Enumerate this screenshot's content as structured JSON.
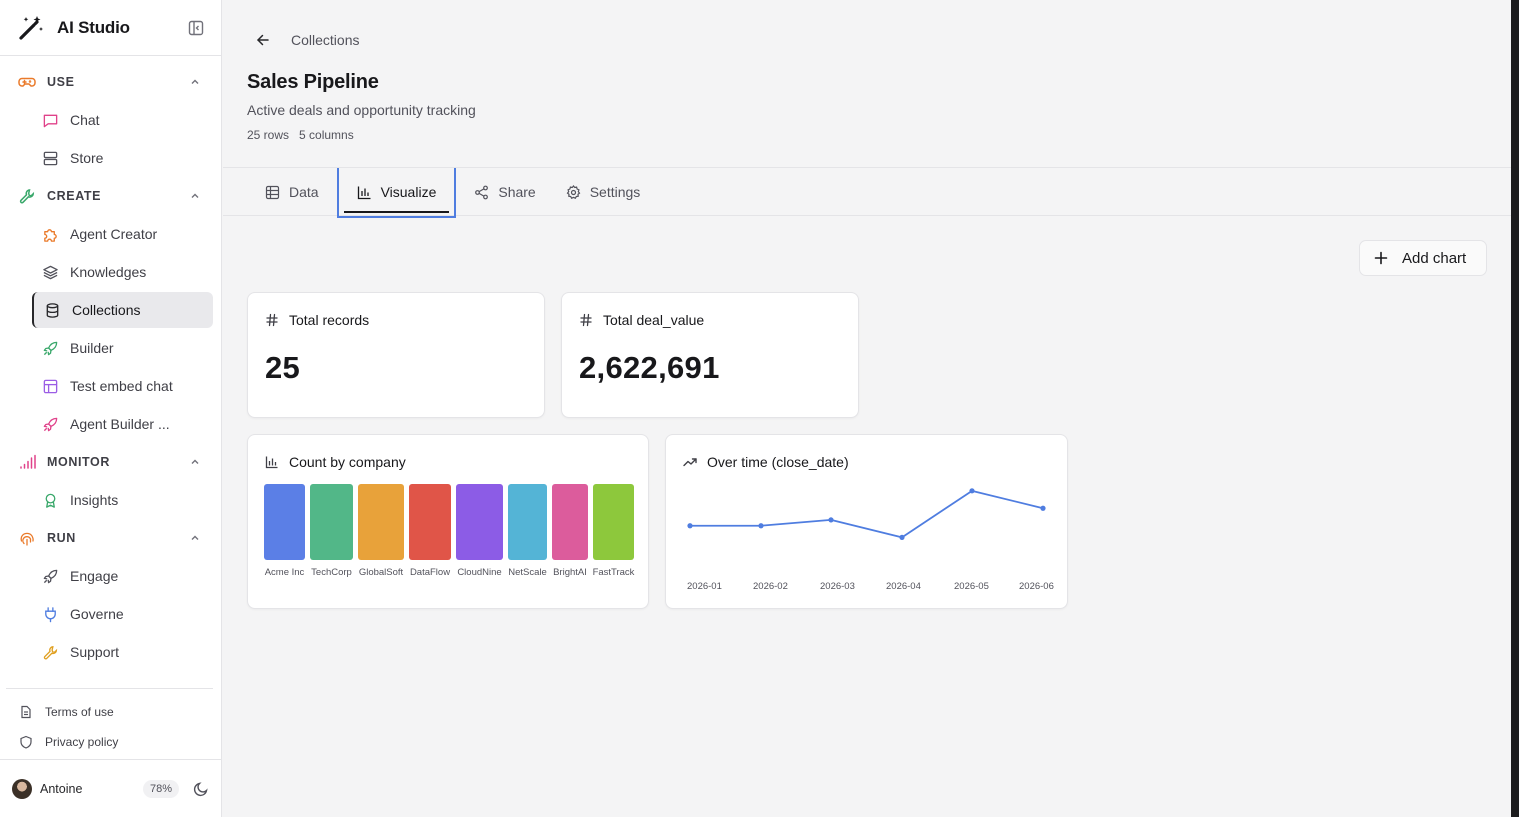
{
  "app": {
    "name": "AI Studio"
  },
  "sidebar": {
    "sections": [
      {
        "label": "USE",
        "icon": "gamepad-icon",
        "color": "#ea7a2a",
        "items": [
          {
            "label": "Chat",
            "icon": "message-square-icon",
            "color": "#e0428a"
          },
          {
            "label": "Store",
            "icon": "server-icon",
            "color": "#52525b"
          }
        ]
      },
      {
        "label": "CREATE",
        "icon": "wrench-icon",
        "color": "#3aa86b",
        "items": [
          {
            "label": "Agent Creator",
            "icon": "puzzle-icon",
            "color": "#ea7a2a"
          },
          {
            "label": "Knowledges",
            "icon": "layers-icon",
            "color": "#52525b"
          },
          {
            "label": "Collections",
            "icon": "database-icon",
            "color": "#27272a",
            "active": true
          },
          {
            "label": "Builder",
            "icon": "rocket-icon",
            "color": "#3aa86b"
          },
          {
            "label": "Test embed chat",
            "icon": "layout-icon",
            "color": "#9b5de5"
          },
          {
            "label": "Agent Builder ...",
            "icon": "rocket-icon",
            "color": "#e0428a"
          }
        ]
      },
      {
        "label": "MONITOR",
        "icon": "signal-icon",
        "color": "#e0428a",
        "items": [
          {
            "label": "Insights",
            "icon": "award-icon",
            "color": "#3aa86b"
          }
        ]
      },
      {
        "label": "RUN",
        "icon": "fingerprint-icon",
        "color": "#ea7a2a",
        "items": [
          {
            "label": "Engage",
            "icon": "rocket-icon",
            "color": "#52525b"
          },
          {
            "label": "Governe",
            "icon": "plug-icon",
            "color": "#4f7de0"
          },
          {
            "label": "Support",
            "icon": "wrench-icon",
            "color": "#e0a020"
          }
        ]
      }
    ],
    "footer": {
      "terms": "Terms of use",
      "privacy": "Privacy policy"
    },
    "user": {
      "name": "Antoine",
      "usage": "78%"
    }
  },
  "header": {
    "breadcrumb": "Collections",
    "title": "Sales Pipeline",
    "description": "Active deals and opportunity tracking",
    "rows": "25 rows",
    "columns": "5 columns"
  },
  "tabs": [
    {
      "label": "Data",
      "icon": "table-icon"
    },
    {
      "label": "Visualize",
      "icon": "bar-chart-icon",
      "active": true
    },
    {
      "label": "Share",
      "icon": "share-icon"
    },
    {
      "label": "Settings",
      "icon": "gear-icon"
    }
  ],
  "actions": {
    "add_chart": "Add chart"
  },
  "stats": {
    "total_records": {
      "label": "Total records",
      "value": "25"
    },
    "total_deal_value": {
      "label": "Total deal_value",
      "value": "2,622,691"
    }
  },
  "chart_data": [
    {
      "type": "bar",
      "title": "Count by company",
      "categories": [
        "Acme Inc",
        "TechCorp",
        "GlobalSoft",
        "DataFlow",
        "CloudNine",
        "NetScale",
        "BrightAI",
        "FastTrack"
      ],
      "values": [
        1,
        1,
        1,
        1,
        1,
        1,
        1,
        1
      ],
      "colors": [
        "#5b7fe6",
        "#52b788",
        "#e8a23a",
        "#e05548",
        "#8c5ce6",
        "#54b4d6",
        "#dc5c9c",
        "#8dc83c"
      ]
    },
    {
      "type": "line",
      "title": "Over time (close_date)",
      "x": [
        "2026-01",
        "2026-02",
        "2026-03",
        "2026-04",
        "2026-05",
        "2026-06"
      ],
      "y": [
        4,
        4,
        5,
        2,
        10,
        7
      ],
      "color": "#4f7de0"
    }
  ]
}
